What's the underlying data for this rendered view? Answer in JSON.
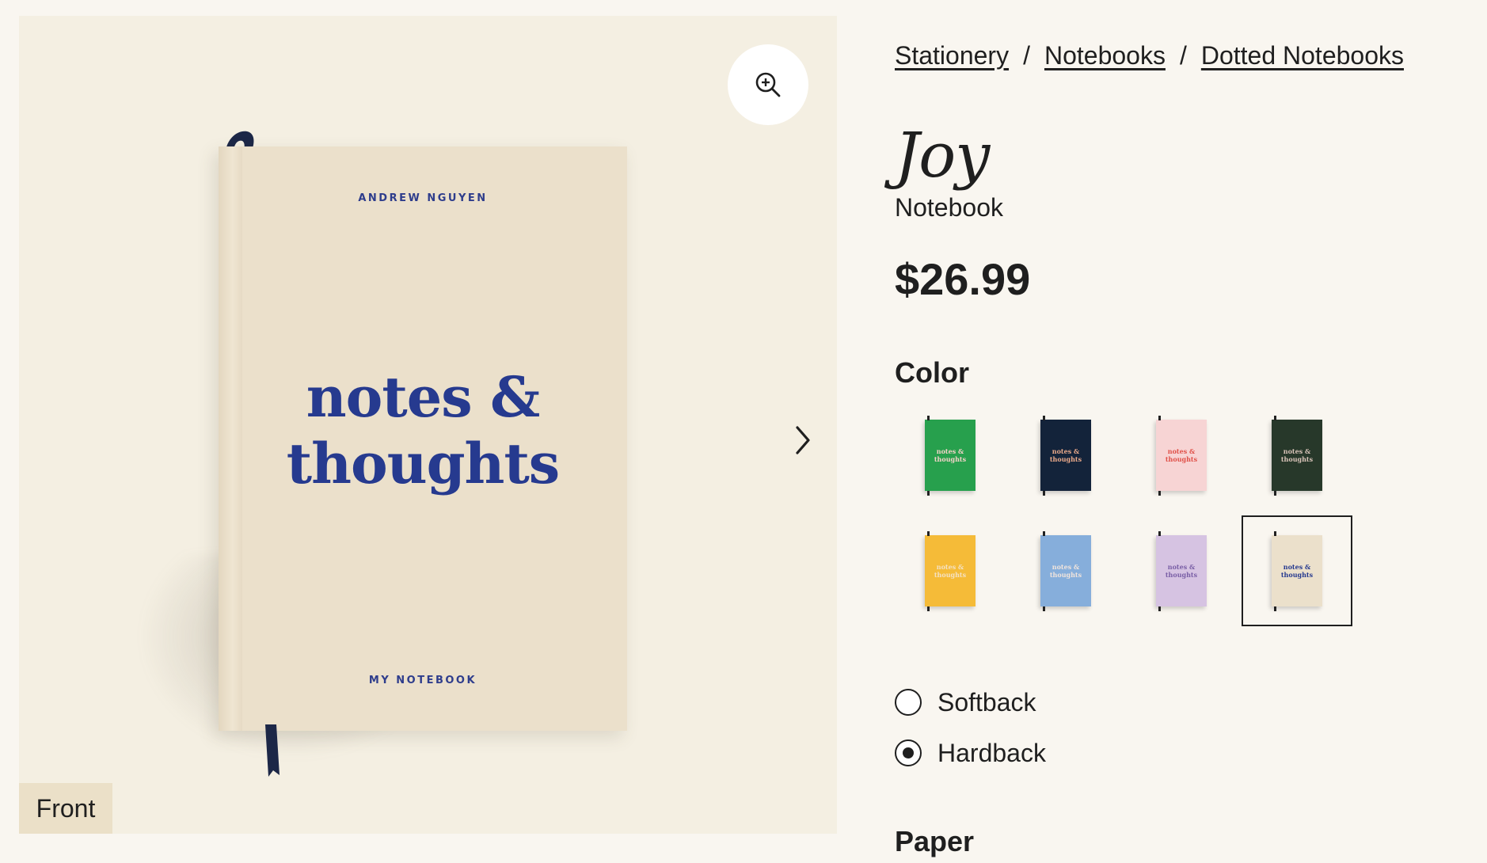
{
  "gallery": {
    "view_label": "Front",
    "book": {
      "author": "ANDREW NGUYEN",
      "title_line1": "notes &",
      "title_line2": "thoughts",
      "subtitle": "MY NOTEBOOK"
    },
    "icons": {
      "zoom": "zoom-in-icon",
      "next": "chevron-right-icon"
    }
  },
  "breadcrumb": [
    "Stationery",
    "Notebooks",
    "Dotted Notebooks"
  ],
  "product": {
    "name": "Joy",
    "type": "Notebook",
    "price": "$26.99"
  },
  "color_section": {
    "title": "Color",
    "swatches": [
      {
        "name": "green",
        "cover": "#27a04d",
        "text": "#f3d3c8",
        "selected": false
      },
      {
        "name": "navy",
        "cover": "#13233a",
        "text": "#e9a98a",
        "selected": false
      },
      {
        "name": "pink",
        "cover": "#f7d4d4",
        "text": "#e0524a",
        "selected": false
      },
      {
        "name": "dark-green",
        "cover": "#27382a",
        "text": "#d8c3b8",
        "selected": false
      },
      {
        "name": "yellow",
        "cover": "#f5bb38",
        "text": "#f4e1c2",
        "selected": false
      },
      {
        "name": "blue",
        "cover": "#86aedb",
        "text": "#f0e4dc",
        "selected": false
      },
      {
        "name": "lavender",
        "cover": "#d6c3e2",
        "text": "#7a5fa6",
        "selected": false
      },
      {
        "name": "cream",
        "cover": "#ebe0cb",
        "text": "#263a8f",
        "selected": true
      }
    ],
    "swatch_label_line1": "notes &",
    "swatch_label_line2": "thoughts"
  },
  "binding": {
    "options": [
      {
        "label": "Softback",
        "selected": false
      },
      {
        "label": "Hardback",
        "selected": true
      }
    ]
  },
  "paper_section": {
    "title": "Paper"
  }
}
